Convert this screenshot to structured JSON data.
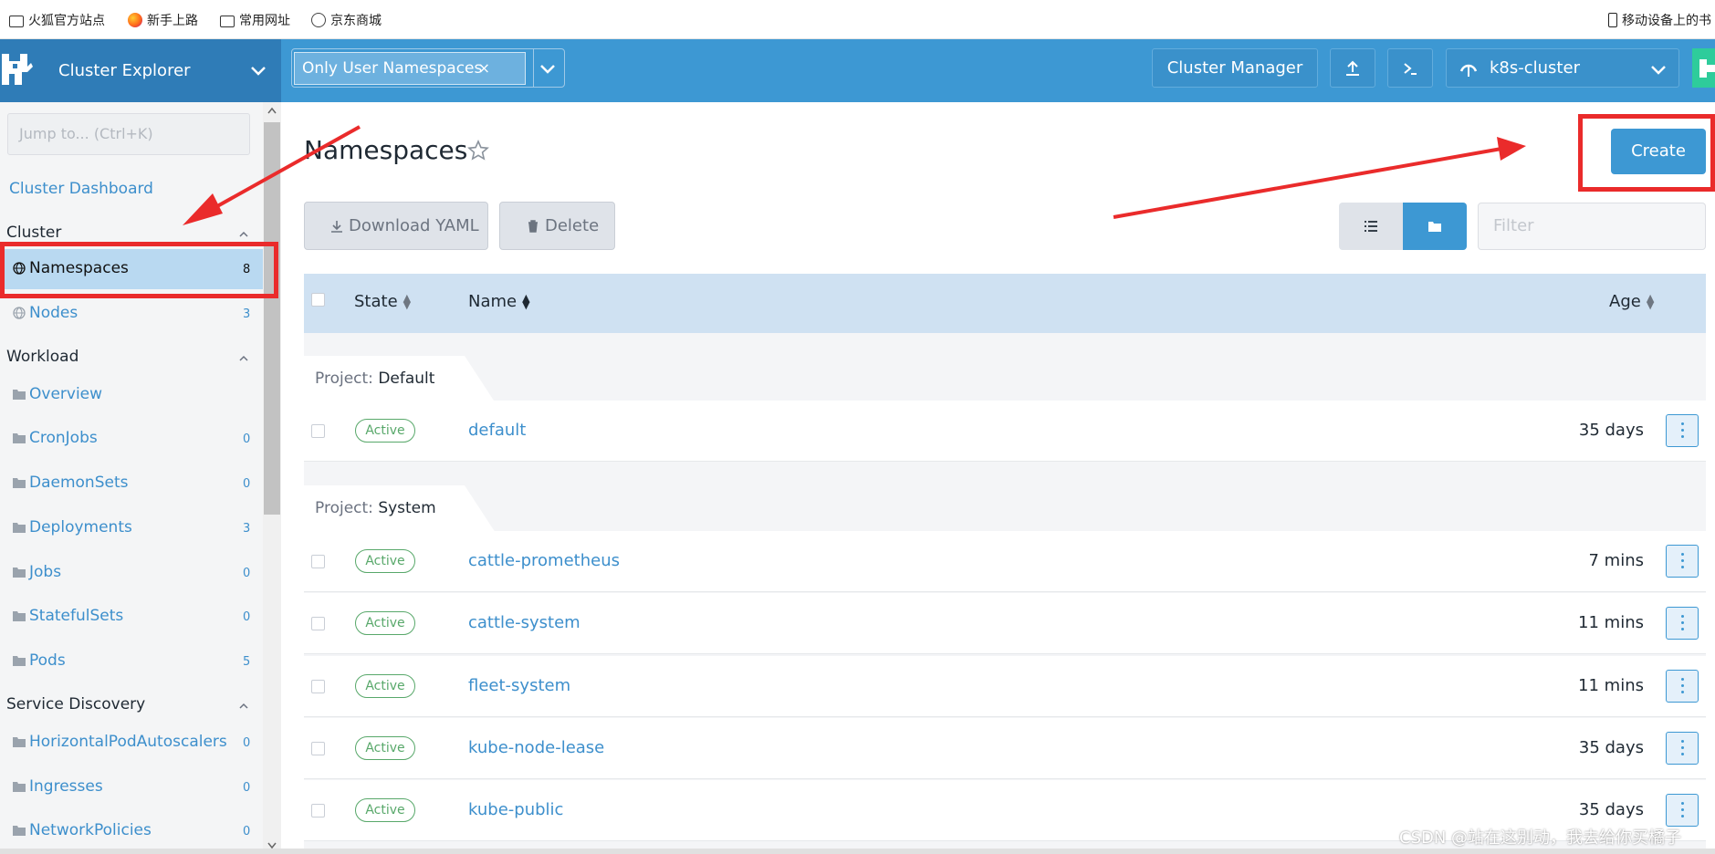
{
  "browser": {
    "bookmarks": [
      "火狐官方站点",
      "新手上路",
      "常用网址",
      "京东商城"
    ],
    "mobile_bookmarks": "移动设备上的书"
  },
  "header": {
    "app_title": "Cluster Explorer",
    "namespace_filter": "Only User Namespaces",
    "namespace_filter_remove": "×",
    "cluster_manager": "Cluster Manager",
    "cluster_name": "k8s-cluster",
    "accent": "#3d98d3"
  },
  "sidebar": {
    "search_placeholder": "Jump to... (Ctrl+K)",
    "dashboard": "Cluster Dashboard",
    "groups": [
      {
        "label": "Cluster",
        "items": [
          {
            "label": "Namespaces",
            "count": "8",
            "active": true
          },
          {
            "label": "Nodes",
            "count": "3"
          }
        ]
      },
      {
        "label": "Workload",
        "items": [
          {
            "label": "Overview",
            "count": ""
          },
          {
            "label": "CronJobs",
            "count": "0"
          },
          {
            "label": "DaemonSets",
            "count": "0"
          },
          {
            "label": "Deployments",
            "count": "3"
          },
          {
            "label": "Jobs",
            "count": "0"
          },
          {
            "label": "StatefulSets",
            "count": "0"
          },
          {
            "label": "Pods",
            "count": "5"
          }
        ]
      },
      {
        "label": "Service Discovery",
        "items": [
          {
            "label": "HorizontalPodAutoscalers",
            "count": "0"
          },
          {
            "label": "Ingresses",
            "count": "0"
          },
          {
            "label": "NetworkPolicies",
            "count": "0"
          }
        ]
      }
    ]
  },
  "main": {
    "title": "Namespaces",
    "create": "Create",
    "download_yaml": "Download YAML",
    "delete": "Delete",
    "filter_placeholder": "Filter",
    "columns": {
      "state": "State",
      "name": "Name",
      "age": "Age"
    },
    "project_key": "Project:",
    "groups": [
      {
        "project": "Default",
        "rows": [
          {
            "state": "Active",
            "name": "default",
            "age": "35 days"
          }
        ]
      },
      {
        "project": "System",
        "rows": [
          {
            "state": "Active",
            "name": "cattle-prometheus",
            "age": "7 mins"
          },
          {
            "state": "Active",
            "name": "cattle-system",
            "age": "11 mins"
          },
          {
            "state": "Active",
            "name": "fleet-system",
            "age": "11 mins"
          },
          {
            "state": "Active",
            "name": "kube-node-lease",
            "age": "35 days"
          },
          {
            "state": "Active",
            "name": "kube-public",
            "age": "35 days"
          }
        ]
      }
    ]
  },
  "watermark": "CSDN @站在这别动，我去给你买橘子",
  "annotation_color": "#ea2b2b"
}
